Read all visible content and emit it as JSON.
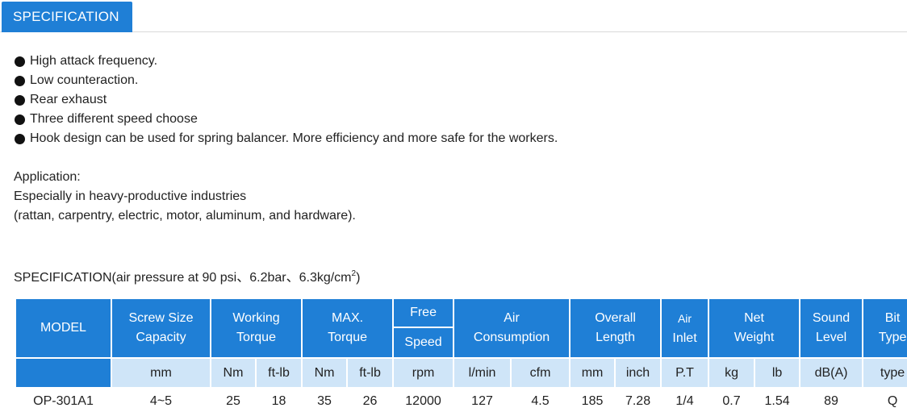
{
  "tab": {
    "label": "SPECIFICATION"
  },
  "features": [
    "High attack frequency.",
    "Low counteraction.",
    "Rear exhaust",
    "Three different speed choose",
    "Hook design can be used for spring balancer. More efficiency and more safe for the workers."
  ],
  "application": {
    "heading": "Application:",
    "line1": "Especially in heavy-productive industries",
    "line2": "(rattan, carpentry, electric, motor, aluminum, and hardware)."
  },
  "spec_heading": {
    "prefix": "SPECIFICATION(air pressure at 90 psi、6.2bar、6.3kg/cm",
    "superscript": "2",
    "suffix": ")"
  },
  "table": {
    "headers": {
      "model": "MODEL",
      "screw_size_1": "Screw Size",
      "screw_size_2": "Capacity",
      "working_1": "Working",
      "working_2": "Torque",
      "max_1": "MAX.",
      "max_2": "Torque",
      "free": "Free",
      "speed": "Speed",
      "air_1": "Air",
      "air_2": "Consumption",
      "overall_1": "Overall",
      "overall_2": "Length",
      "inlet_1": "Air",
      "inlet_2": "Inlet",
      "net_1": "Net",
      "net_2": "Weight",
      "sound_1": "Sound",
      "sound_2": "Level",
      "bit_1": "Bit",
      "bit_2": "Type"
    },
    "units": [
      "mm",
      "Nm",
      "ft-lb",
      "Nm",
      "ft-lb",
      "rpm",
      "l/min",
      "cfm",
      "mm",
      "inch",
      "P.T",
      "kg",
      "lb",
      "dB(A)",
      "type"
    ],
    "rows": [
      {
        "model": "OP-301A1",
        "values": [
          "4~5",
          "25",
          "18",
          "35",
          "26",
          "12000",
          "127",
          "4.5",
          "185",
          "7.28",
          "1/4",
          "0.7",
          "1.54",
          "89",
          "Q"
        ]
      }
    ]
  },
  "colors": {
    "header_blue": "#1f7fd6",
    "unit_row_blue": "#cfe5f8",
    "bit_type_red": "#e02020"
  }
}
